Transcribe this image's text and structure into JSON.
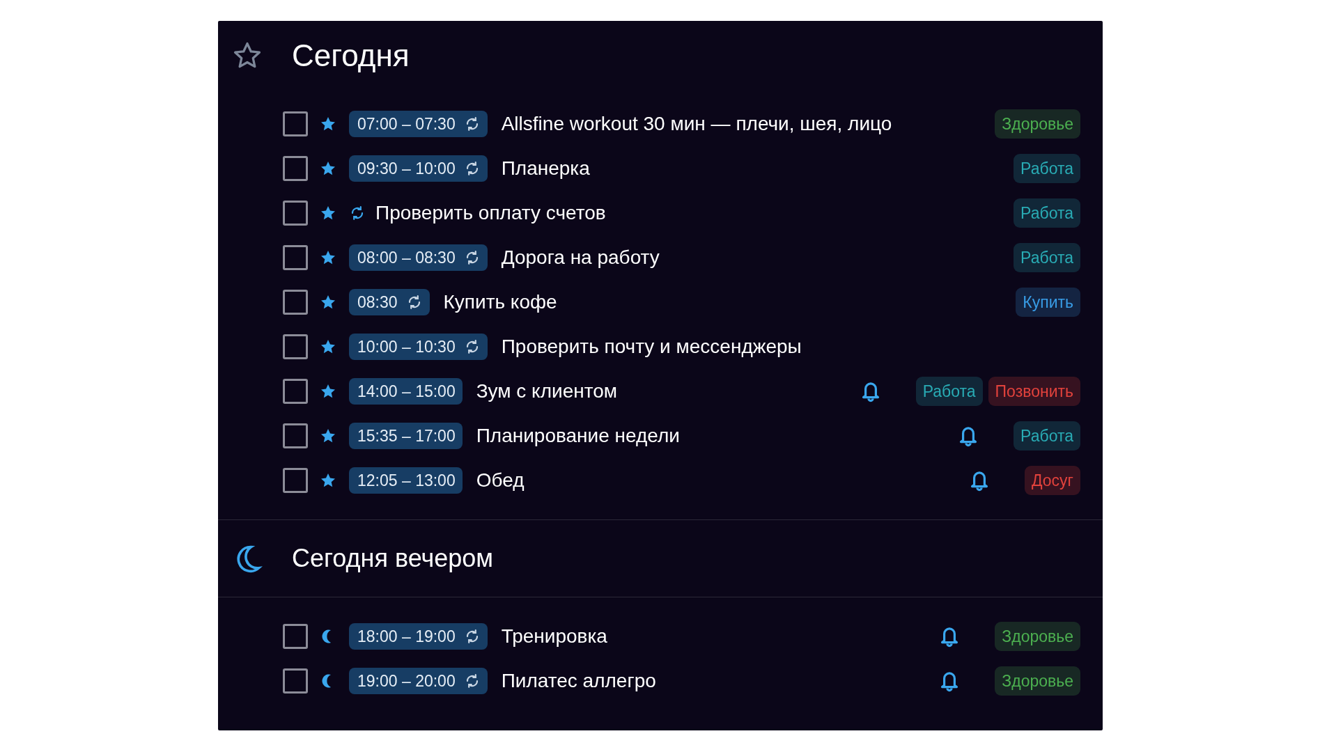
{
  "sections": [
    {
      "kind": "star",
      "title": "Сегодня",
      "tasks": [
        {
          "checked": false,
          "time": "07:00 – 07:30",
          "repeat": true,
          "title": "Allsfine workout 30 мин — плечи, шея, лицо",
          "reminder": false,
          "tags": [
            {
              "label": "Здоровье",
              "color": "#182824"
            }
          ]
        },
        {
          "checked": false,
          "time": "09:30 – 10:00",
          "repeat": true,
          "title": "Планерка",
          "reminder": false,
          "tags": [
            {
              "label": "Работа",
              "color": "#112738"
            }
          ]
        },
        {
          "checked": false,
          "repeat": true,
          "title": "Проверить оплату счетов",
          "reminder": false,
          "tags": [
            {
              "label": "Работа",
              "color": "#112738"
            }
          ]
        },
        {
          "checked": false,
          "time": "08:00 – 08:30",
          "repeat": true,
          "title": "Дорога на работу",
          "reminder": false,
          "tags": [
            {
              "label": "Работа",
              "color": "#112738"
            }
          ]
        },
        {
          "checked": false,
          "time": "08:30",
          "repeat": true,
          "title": "Купить кофе",
          "reminder": false,
          "tags": [
            {
              "label": "Купить",
              "color": "#142442"
            }
          ]
        },
        {
          "checked": false,
          "time": "10:00 – 10:30",
          "repeat": true,
          "title": "Проверить почту и мессенджеры",
          "reminder": false
        },
        {
          "checked": false,
          "time": "14:00 – 15:00",
          "repeat": false,
          "title": "Зум с клиентом",
          "reminder": true,
          "tags": [
            {
              "label": "Работа",
              "color": "#112738"
            },
            {
              "label": "Позвонить",
              "color": "#361220"
            }
          ]
        },
        {
          "checked": false,
          "time": "15:35 – 17:00",
          "repeat": false,
          "title": "Планирование недели",
          "reminder": true,
          "tags": [
            {
              "label": "Работа",
              "color": "#112738"
            }
          ]
        },
        {
          "checked": false,
          "time": "12:05 – 13:00",
          "repeat": false,
          "title": "Обед",
          "reminder": true,
          "tags": [
            {
              "label": "Досуг",
              "color": "#361220"
            }
          ]
        }
      ]
    },
    {
      "kind": "moon",
      "title": "Сегодня вечером",
      "tasks": [
        {
          "checked": false,
          "time": "18:00 – 19:00",
          "repeat": true,
          "title": "Тренировка",
          "reminder": true,
          "tags": [
            {
              "label": "Здоровье",
              "color": "#182824"
            }
          ]
        },
        {
          "checked": false,
          "time": "19:00 – 20:00",
          "repeat": true,
          "title": "Пилатес аллегро",
          "reminder": true,
          "tags": [
            {
              "label": "Здоровье",
              "color": "#182824"
            }
          ]
        }
      ]
    }
  ]
}
